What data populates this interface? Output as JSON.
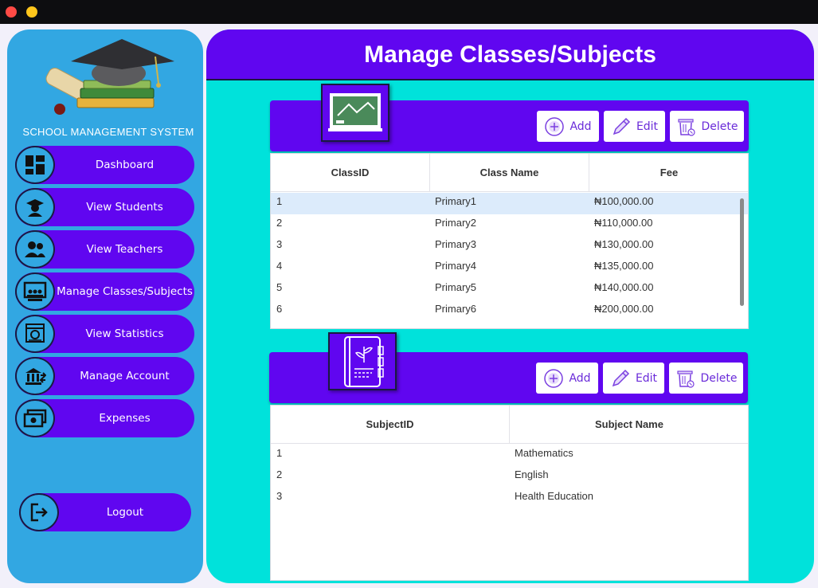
{
  "window": {
    "buttons": [
      "close",
      "minimize"
    ]
  },
  "sidebar": {
    "app_title": "SCHOOL MANAGEMENT SYSTEM",
    "items": [
      {
        "label": "Dashboard",
        "icon": "dashboard-icon"
      },
      {
        "label": "View Students",
        "icon": "graduate-icon"
      },
      {
        "label": "View Teachers",
        "icon": "teachers-icon"
      },
      {
        "label": "Manage Classes/Subjects",
        "icon": "classroom-icon"
      },
      {
        "label": "View Statistics",
        "icon": "statistics-icon"
      },
      {
        "label": "Manage Account",
        "icon": "bank-icon"
      },
      {
        "label": "Expenses",
        "icon": "money-icon"
      }
    ],
    "logout": {
      "label": "Logout",
      "icon": "logout-icon"
    }
  },
  "main": {
    "title": "Manage Classes/Subjects"
  },
  "classes_panel": {
    "icon": "chalkboard-icon",
    "buttons": {
      "add": "Add",
      "edit": "Edit",
      "delete": "Delete"
    },
    "columns": [
      "ClassID",
      "Class Name",
      "Fee"
    ],
    "rows": [
      [
        "1",
        "Primary1",
        "₦100,000.00"
      ],
      [
        "2",
        "Primary2",
        "₦110,000.00"
      ],
      [
        "3",
        "Primary3",
        "₦130,000.00"
      ],
      [
        "4",
        "Primary4",
        "₦135,000.00"
      ],
      [
        "5",
        "Primary5",
        "₦140,000.00"
      ],
      [
        "6",
        "Primary6",
        "₦200,000.00"
      ]
    ]
  },
  "subjects_panel": {
    "icon": "notebook-icon",
    "buttons": {
      "add": "Add",
      "edit": "Edit",
      "delete": "Delete"
    },
    "columns": [
      "SubjectID",
      "Subject Name"
    ],
    "rows": [
      [
        "1",
        "Mathematics"
      ],
      [
        "2",
        "English"
      ],
      [
        "3",
        "Health Education"
      ]
    ]
  },
  "colors": {
    "accent": "#6006f0",
    "sidebar": "#32a7e2",
    "main_bg": "#00e2db",
    "button_text": "#6a2bd9"
  }
}
